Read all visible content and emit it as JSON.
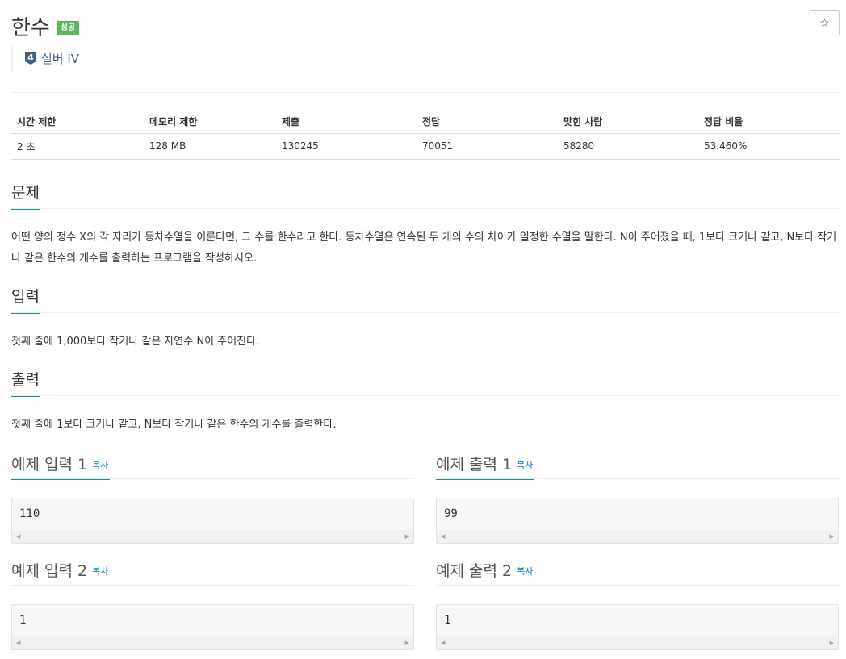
{
  "problem": {
    "title": "한수",
    "status_badge": "성공",
    "star": "☆"
  },
  "tier": {
    "level_num": "4",
    "label": "실버 IV"
  },
  "info_table": {
    "headers": [
      "시간 제한",
      "메모리 제한",
      "제출",
      "정답",
      "맞힌 사람",
      "정답 비율"
    ],
    "values": [
      "2 초",
      "128 MB",
      "130245",
      "70051",
      "58280",
      "53.460%"
    ]
  },
  "sections": {
    "problem": {
      "heading": "문제",
      "text": "어떤 양의 정수 X의 각 자리가 등차수열을 이룬다면, 그 수를 한수라고 한다. 등차수열은 연속된 두 개의 수의 차이가 일정한 수열을 말한다. N이 주어졌을 때, 1보다 크거나 같고, N보다 작거나 같은 한수의 개수를 출력하는 프로그램을 작성하시오."
    },
    "input": {
      "heading": "입력",
      "text": "첫째 줄에 1,000보다 작거나 같은 자연수 N이 주어진다."
    },
    "output": {
      "heading": "출력",
      "text": "첫째 줄에 1보다 크거나 같고, N보다 작거나 같은 한수의 개수를 출력한다."
    }
  },
  "examples": {
    "copy_label": "복사",
    "input1": {
      "title": "예제 입력 1",
      "value": "110"
    },
    "output1": {
      "title": "예제 출력 1",
      "value": "99"
    },
    "input2": {
      "title": "예제 입력 2",
      "value": "1"
    },
    "output2": {
      "title": "예제 출력 2",
      "value": "1"
    }
  },
  "colors": {
    "success": "#5cb85c",
    "link": "#0076c0",
    "tier_silver": "#435f7a",
    "accent_underline": "#1a8c8c"
  }
}
